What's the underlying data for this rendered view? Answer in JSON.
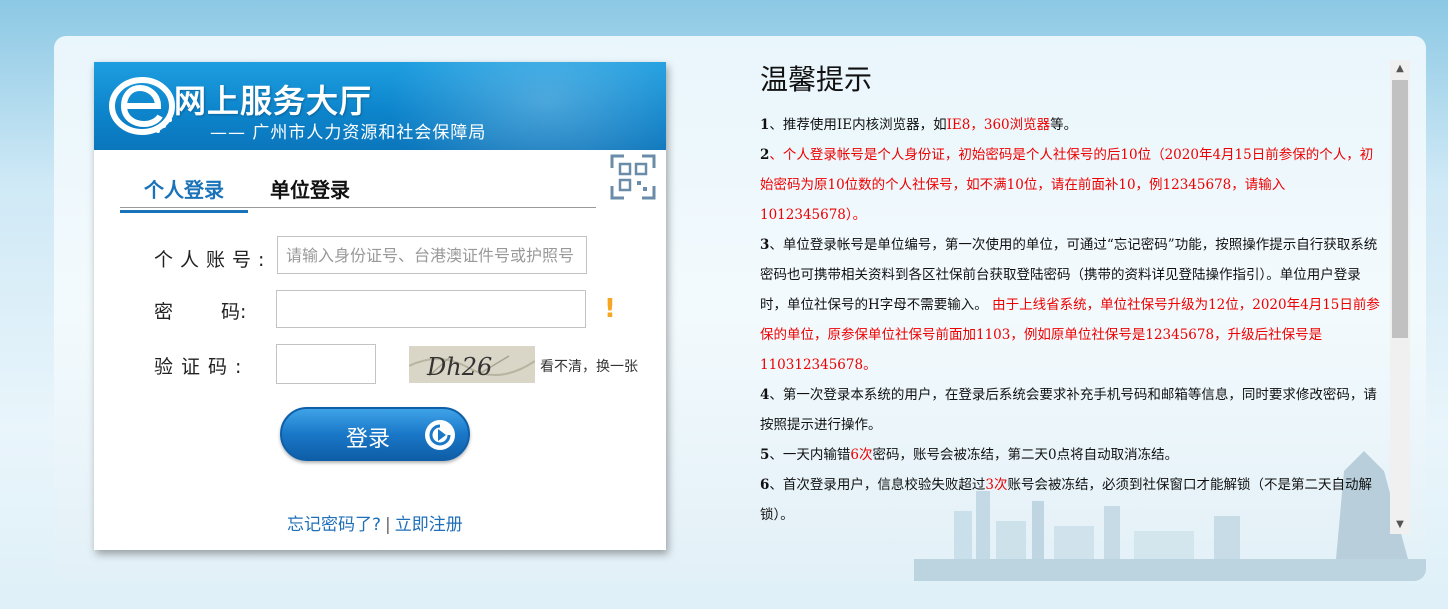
{
  "header": {
    "title": "网上服务大厅",
    "subtitle": "—— 广州市人力资源和社会保障局"
  },
  "tabs": {
    "personal": "个人登录",
    "unit": "单位登录"
  },
  "form": {
    "account_label": "个人账号:",
    "password_label_left": "密",
    "password_label_right": "码:",
    "code_label": "验证码:",
    "account_placeholder": "请输入身份证号、台港澳证件号或护照号",
    "captcha_text": "Dh26",
    "refresh_text": "看不清，换一张",
    "login_label": "登录"
  },
  "links": {
    "forgot": "忘记密码了?",
    "separator": "|",
    "register": "立即注册"
  },
  "tips": {
    "title": "温馨提示",
    "items": [
      {
        "n": "1",
        "pre": "、推荐使用IE内核浏览器，如",
        "red": "IE8，360浏览器",
        "post": "等。"
      },
      {
        "n": "2",
        "pre": "",
        "red": "、个人登录帐号是个人身份证，初始密码是个人社保号的后10位（2020年4月15日前参保的个人，初始密码为原10位数的个人社保号，如不满10位，请在前面补10，例12345678，请输入1012345678）。",
        "post": ""
      },
      {
        "n": "3",
        "pre": "、单位登录帐号是单位编号，第一次使用的单位，可通过“忘记密码”功能，按照操作提示自行获取系统密码也可携带相关资料到各区社保前台获取登陆密码（携带的资料详见登陆操作指引）。单位用户登录时，单位社保号的H字母不需要输入。",
        "red": " 由于上线省系统，单位社保号升级为12位，2020年4月15日前参保的单位，原参保单位社保号前面加1103，例如原单位社保号是12345678，升级后社保号是110312345678。",
        "post": ""
      },
      {
        "n": "4",
        "pre": "、第一次登录本系统的用户，在登录后系统会要求补充手机号码和邮箱等信息，同时要求修改密码，请按照提示进行操作。",
        "red": "",
        "post": ""
      },
      {
        "n": "5",
        "pre": "、一天内输错",
        "red": "6次",
        "post": "密码，账号会被冻结，第二天0点将自动取消冻结。"
      },
      {
        "n": "6",
        "pre": "、首次登录用户，信息校验失败超过",
        "red": "3次",
        "post": "账号会被冻结，必须到社保窗口才能解锁（不是第二天自动解锁）。"
      }
    ]
  },
  "colors": {
    "accent": "#1a73b8",
    "header_blue": "#0d85cc",
    "warning": "#f5a623",
    "tip_red": "#e00000"
  },
  "icons": [
    "e-logo-icon",
    "qr-code-icon",
    "warning-icon",
    "arrow-right-icon",
    "scroll-up-icon",
    "scroll-down-icon"
  ]
}
